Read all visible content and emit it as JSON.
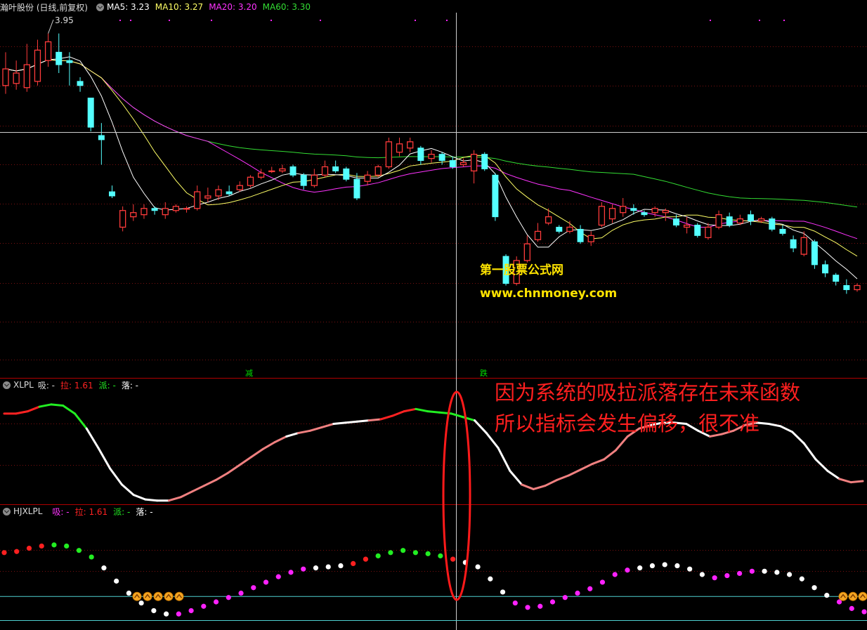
{
  "main_header": {
    "stock_title": "瀚叶股份 (日线,前复权)",
    "ma5": "MA5: 3.23",
    "ma10": "MA10: 3.27",
    "ma20": "MA20: 3.20",
    "ma60": "MA60: 3.30"
  },
  "xlpl_header": {
    "name": "XLPL",
    "xi": "吸: -",
    "la": "拉: 1.61",
    "pai": "派: -",
    "luo": "落: -"
  },
  "hjxlpl_header": {
    "name": "HJXLPL",
    "xi": "吸: -",
    "la": "拉: 1.61",
    "pai": "派: -",
    "luo": "落: -"
  },
  "high_label": "3.95",
  "markers": {
    "jian": "减",
    "die": "跌"
  },
  "watermark": {
    "site_name": "第一股票公式网",
    "url": "www.chnmoney.com"
  },
  "annotation": {
    "line1": "因为系统的吸拉派落存在未来函数",
    "line2": "所以指标会发生偏移，很不准"
  },
  "colors": {
    "up": "#ff3b3b",
    "down": "#54ffff",
    "ma5": "#ffffff",
    "ma10": "#ffff66",
    "ma20": "#ff33ff",
    "ma60": "#33dd33",
    "xi": "#ff22ff",
    "la": "#ff2222",
    "pai": "#22ee22",
    "luo": "#ffffff",
    "annotation": "#ff1f1f",
    "watermark": "#ffe400"
  },
  "chart_data": [
    {
      "type": "candlestick",
      "ylim": [
        2.3,
        4.05
      ],
      "candles": [
        [
          3.7,
          3.78,
          3.86,
          3.66
        ],
        [
          3.71,
          3.76,
          3.82,
          3.68
        ],
        [
          3.69,
          3.8,
          3.9,
          3.67
        ],
        [
          3.72,
          3.87,
          3.92,
          3.7
        ],
        [
          3.82,
          3.91,
          3.95,
          3.79
        ],
        [
          3.86,
          3.8,
          3.95,
          3.76
        ],
        [
          3.82,
          3.81,
          3.86,
          3.7
        ],
        [
          3.72,
          3.7,
          3.74,
          3.67
        ],
        [
          3.64,
          3.5,
          3.64,
          3.48
        ],
        [
          3.46,
          3.44,
          3.52,
          3.32
        ],
        [
          3.19,
          3.17,
          3.22,
          3.16
        ],
        [
          3.02,
          3.1,
          3.12,
          3.0
        ],
        [
          3.07,
          3.09,
          3.13,
          3.05
        ],
        [
          3.08,
          3.11,
          3.13,
          3.06
        ],
        [
          3.11,
          3.1,
          3.12,
          3.08
        ],
        [
          3.08,
          3.11,
          3.14,
          3.06
        ],
        [
          3.1,
          3.12,
          3.13,
          3.09
        ],
        [
          3.11,
          3.11,
          3.12,
          3.09
        ],
        [
          3.11,
          3.19,
          3.22,
          3.1
        ],
        [
          3.16,
          3.17,
          3.21,
          3.14
        ],
        [
          3.17,
          3.2,
          3.22,
          3.15
        ],
        [
          3.19,
          3.18,
          3.22,
          3.17
        ],
        [
          3.2,
          3.22,
          3.24,
          3.19
        ],
        [
          3.22,
          3.26,
          3.27,
          3.21
        ],
        [
          3.26,
          3.28,
          3.3,
          3.25
        ],
        [
          3.29,
          3.29,
          3.31,
          3.28
        ],
        [
          3.29,
          3.3,
          3.32,
          3.28
        ],
        [
          3.31,
          3.27,
          3.32,
          3.26
        ],
        [
          3.27,
          3.22,
          3.28,
          3.2
        ],
        [
          3.22,
          3.27,
          3.3,
          3.21
        ],
        [
          3.27,
          3.31,
          3.34,
          3.26
        ],
        [
          3.31,
          3.29,
          3.34,
          3.28
        ],
        [
          3.3,
          3.25,
          3.31,
          3.24
        ],
        [
          3.25,
          3.16,
          3.28,
          3.15
        ],
        [
          3.24,
          3.27,
          3.29,
          3.22
        ],
        [
          3.27,
          3.31,
          3.32,
          3.26
        ],
        [
          3.31,
          3.43,
          3.45,
          3.3
        ],
        [
          3.38,
          3.42,
          3.45,
          3.36
        ],
        [
          3.4,
          3.43,
          3.45,
          3.38
        ],
        [
          3.4,
          3.34,
          3.41,
          3.32
        ],
        [
          3.35,
          3.37,
          3.39,
          3.33
        ],
        [
          3.37,
          3.34,
          3.38,
          3.32
        ],
        [
          3.34,
          3.31,
          3.36,
          3.3
        ],
        [
          3.32,
          3.33,
          3.35,
          3.31
        ],
        [
          3.29,
          3.37,
          3.39,
          3.23
        ],
        [
          3.37,
          3.3,
          3.38,
          3.29
        ],
        [
          3.27,
          3.07,
          3.28,
          3.05
        ],
        [
          2.88,
          2.75,
          2.89,
          2.74
        ],
        [
          2.75,
          2.86,
          2.88,
          2.74
        ],
        [
          2.86,
          2.94,
          2.98,
          2.85
        ],
        [
          2.96,
          3.0,
          3.04,
          2.95
        ],
        [
          3.04,
          3.07,
          3.11,
          3.03
        ],
        [
          3.02,
          3.0,
          3.03,
          2.99
        ],
        [
          3.0,
          3.02,
          3.05,
          2.99
        ],
        [
          3.01,
          2.95,
          3.03,
          2.94
        ],
        [
          2.95,
          2.98,
          3.0,
          2.93
        ],
        [
          3.03,
          3.12,
          3.14,
          3.02
        ],
        [
          3.06,
          3.11,
          3.13,
          3.04
        ],
        [
          3.09,
          3.12,
          3.16,
          3.07
        ],
        [
          3.11,
          3.1,
          3.13,
          3.08
        ],
        [
          3.09,
          3.08,
          3.1,
          3.07
        ],
        [
          3.09,
          3.11,
          3.12,
          3.07
        ],
        [
          3.09,
          3.1,
          3.11,
          3.05
        ],
        [
          3.06,
          3.03,
          3.08,
          3.02
        ],
        [
          3.02,
          3.03,
          3.07,
          2.99
        ],
        [
          3.03,
          2.98,
          3.04,
          2.97
        ],
        [
          2.97,
          3.02,
          3.04,
          2.96
        ],
        [
          3.02,
          3.08,
          3.1,
          3.01
        ],
        [
          3.07,
          3.03,
          3.09,
          3.02
        ],
        [
          3.04,
          3.06,
          3.08,
          3.03
        ],
        [
          3.08,
          3.05,
          3.1,
          3.03
        ],
        [
          3.05,
          3.06,
          3.07,
          3.04
        ],
        [
          3.06,
          3.01,
          3.07,
          3.0
        ],
        [
          3.01,
          2.99,
          3.03,
          2.98
        ],
        [
          2.96,
          2.92,
          2.98,
          2.9
        ],
        [
          2.89,
          2.97,
          3.0,
          2.88
        ],
        [
          2.95,
          2.84,
          2.96,
          2.82
        ],
        [
          2.84,
          2.8,
          2.86,
          2.78
        ],
        [
          2.79,
          2.76,
          2.8,
          2.74
        ],
        [
          2.74,
          2.72,
          2.77,
          2.7
        ],
        [
          2.72,
          2.74,
          2.75,
          2.71
        ]
      ],
      "ma_lines": [
        "MA5",
        "MA10",
        "MA20",
        "MA60"
      ]
    },
    {
      "type": "line",
      "name": "XLPL",
      "values": [
        0.78,
        0.78,
        0.8,
        0.84,
        0.86,
        0.85,
        0.78,
        0.65,
        0.48,
        0.3,
        0.16,
        0.07,
        0.03,
        0.02,
        0.02,
        0.05,
        0.1,
        0.15,
        0.2,
        0.26,
        0.33,
        0.4,
        0.47,
        0.53,
        0.58,
        0.61,
        0.63,
        0.66,
        0.69,
        0.7,
        0.71,
        0.72,
        0.73,
        0.76,
        0.8,
        0.82,
        0.8,
        0.79,
        0.78,
        0.75,
        0.72,
        0.61,
        0.48,
        0.28,
        0.16,
        0.12,
        0.15,
        0.2,
        0.24,
        0.29,
        0.34,
        0.38,
        0.46,
        0.58,
        0.65,
        0.68,
        0.7,
        0.7,
        0.69,
        0.63,
        0.58,
        0.6,
        0.63,
        0.68,
        0.7,
        0.69,
        0.67,
        0.62,
        0.52,
        0.38,
        0.28,
        0.21,
        0.18,
        0.19
      ],
      "states": [
        "la",
        "la",
        "la",
        "la",
        "pai",
        "pai",
        "pai",
        "pai",
        "luo",
        "luo",
        "luo",
        "luo",
        "luo",
        "luo",
        "luo",
        "xi",
        "xi",
        "xi",
        "xi",
        "xi",
        "xi",
        "xi",
        "xi",
        "xi",
        "xi",
        "luo",
        "xi",
        "xi",
        "xi",
        "luo",
        "luo",
        "luo",
        "xi",
        "la",
        "la",
        "la",
        "pai",
        "pai",
        "pai",
        "pai",
        "pai",
        "luo",
        "luo",
        "luo",
        "luo",
        "xi",
        "xi",
        "xi",
        "xi",
        "xi",
        "xi",
        "xi",
        "xi",
        "xi",
        "xi",
        "xi",
        "luo",
        "luo",
        "luo",
        "luo",
        "luo",
        "xi",
        "xi",
        "xi",
        "xi",
        "luo",
        "luo",
        "luo",
        "luo",
        "luo",
        "luo",
        "luo",
        "xi",
        "xi"
      ]
    },
    {
      "type": "scatter",
      "name": "HJXLPL",
      "values": [
        0.7,
        0.71,
        0.74,
        0.76,
        0.77,
        0.76,
        0.72,
        0.66,
        0.56,
        0.44,
        0.33,
        0.24,
        0.17,
        0.14,
        0.14,
        0.17,
        0.21,
        0.25,
        0.29,
        0.33,
        0.38,
        0.43,
        0.48,
        0.52,
        0.55,
        0.56,
        0.57,
        0.58,
        0.6,
        0.64,
        0.67,
        0.7,
        0.72,
        0.7,
        0.69,
        0.67,
        0.64,
        0.61,
        0.57,
        0.46,
        0.34,
        0.24,
        0.2,
        0.21,
        0.25,
        0.29,
        0.33,
        0.37,
        0.43,
        0.5,
        0.54,
        0.56,
        0.58,
        0.59,
        0.58,
        0.55,
        0.5,
        0.47,
        0.49,
        0.51,
        0.53,
        0.53,
        0.52,
        0.5,
        0.46,
        0.38,
        0.31,
        0.25,
        0.19,
        0.16
      ],
      "states": [
        "la",
        "la",
        "la",
        "la",
        "pai",
        "pai",
        "pai",
        "pai",
        "luo",
        "luo",
        "luo",
        "luo",
        "luo",
        "luo",
        "xi",
        "xi",
        "xi",
        "xi",
        "xi",
        "xi",
        "xi",
        "xi",
        "xi",
        "xi",
        "xi",
        "luo",
        "luo",
        "luo",
        "la",
        "la",
        "pai",
        "pai",
        "pai",
        "pai",
        "pai",
        "pai",
        "la",
        "luo",
        "luo",
        "luo",
        "luo",
        "xi",
        "xi",
        "xi",
        "xi",
        "xi",
        "xi",
        "xi",
        "xi",
        "xi",
        "xi",
        "luo",
        "luo",
        "luo",
        "luo",
        "luo",
        "luo",
        "xi",
        "xi",
        "xi",
        "xi",
        "luo",
        "luo",
        "luo",
        "luo",
        "luo",
        "luo",
        "xi",
        "xi",
        "xi"
      ],
      "level_lines": [
        0.3,
        0.08
      ]
    }
  ]
}
